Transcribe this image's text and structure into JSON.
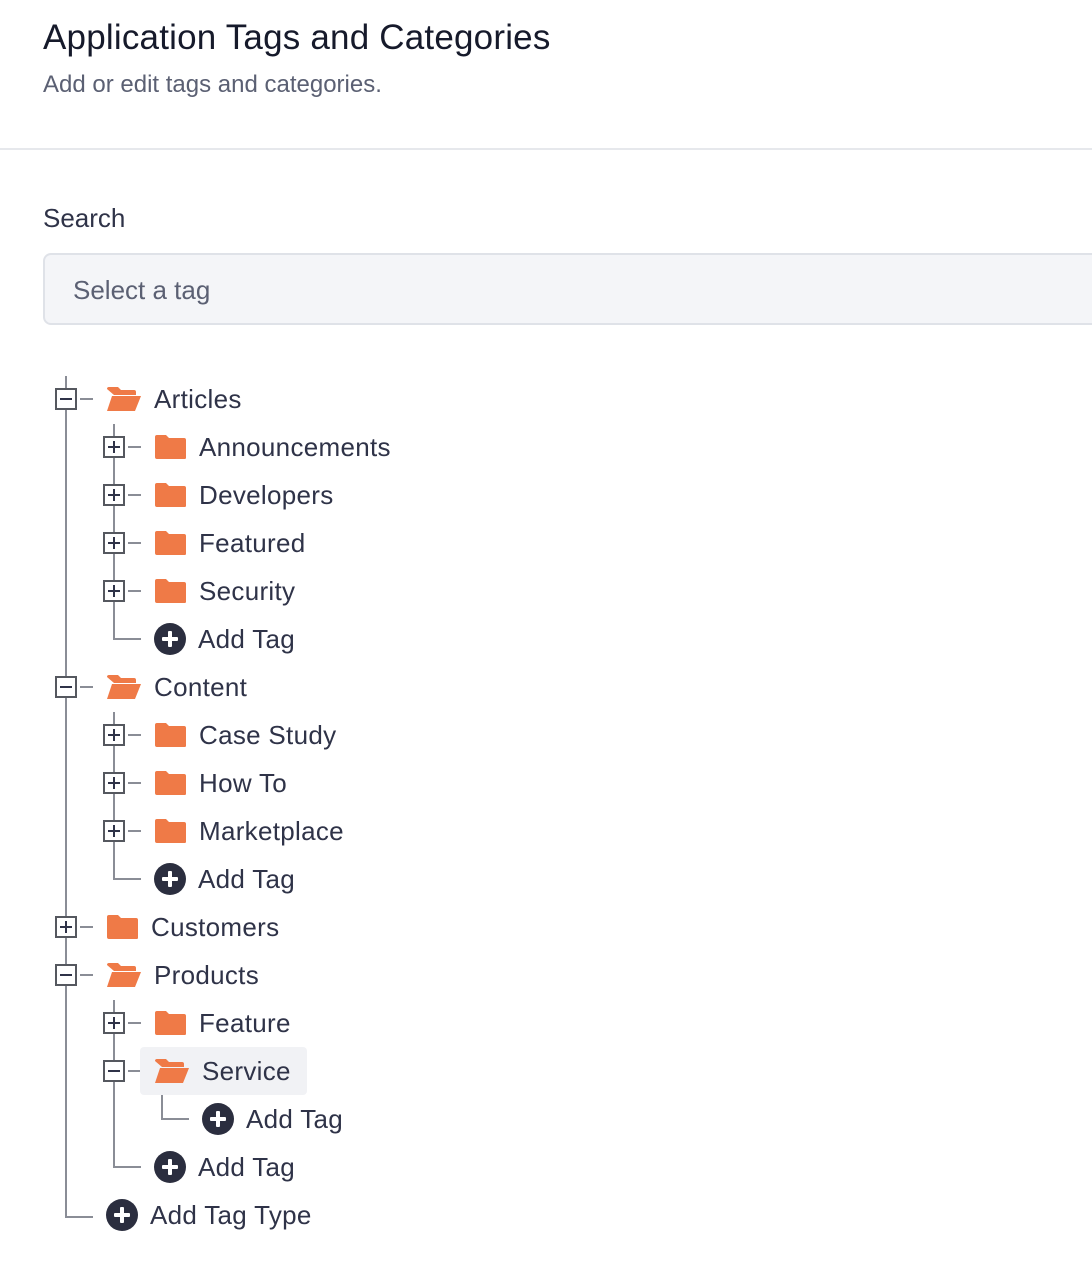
{
  "header": {
    "title": "Application Tags and Categories",
    "subtitle": "Add or edit tags and categories."
  },
  "search": {
    "label": "Search",
    "placeholder": "Select a tag"
  },
  "tree": {
    "articles": {
      "label": "Articles",
      "expanded": true,
      "children": {
        "announcements": "Announcements",
        "developers": "Developers",
        "featured": "Featured",
        "security": "Security"
      },
      "add_tag": "Add Tag"
    },
    "content": {
      "label": "Content",
      "expanded": true,
      "children": {
        "case_study": "Case Study",
        "how_to": "How To",
        "marketplace": "Marketplace"
      },
      "add_tag": "Add Tag"
    },
    "customers": {
      "label": "Customers",
      "expanded": false
    },
    "products": {
      "label": "Products",
      "expanded": true,
      "children": {
        "feature": "Feature",
        "service": {
          "label": "Service",
          "expanded": true,
          "selected": true,
          "add_tag": "Add Tag"
        }
      },
      "add_tag": "Add Tag"
    },
    "add_tag_type": "Add Tag Type"
  },
  "colors": {
    "folder": "#ef7a47",
    "text": "#2f3348",
    "add_icon": "#2b2e3f"
  },
  "icons": {
    "open_folder": "folder-open-icon",
    "closed_folder": "folder-icon",
    "add": "plus-circle-icon"
  }
}
